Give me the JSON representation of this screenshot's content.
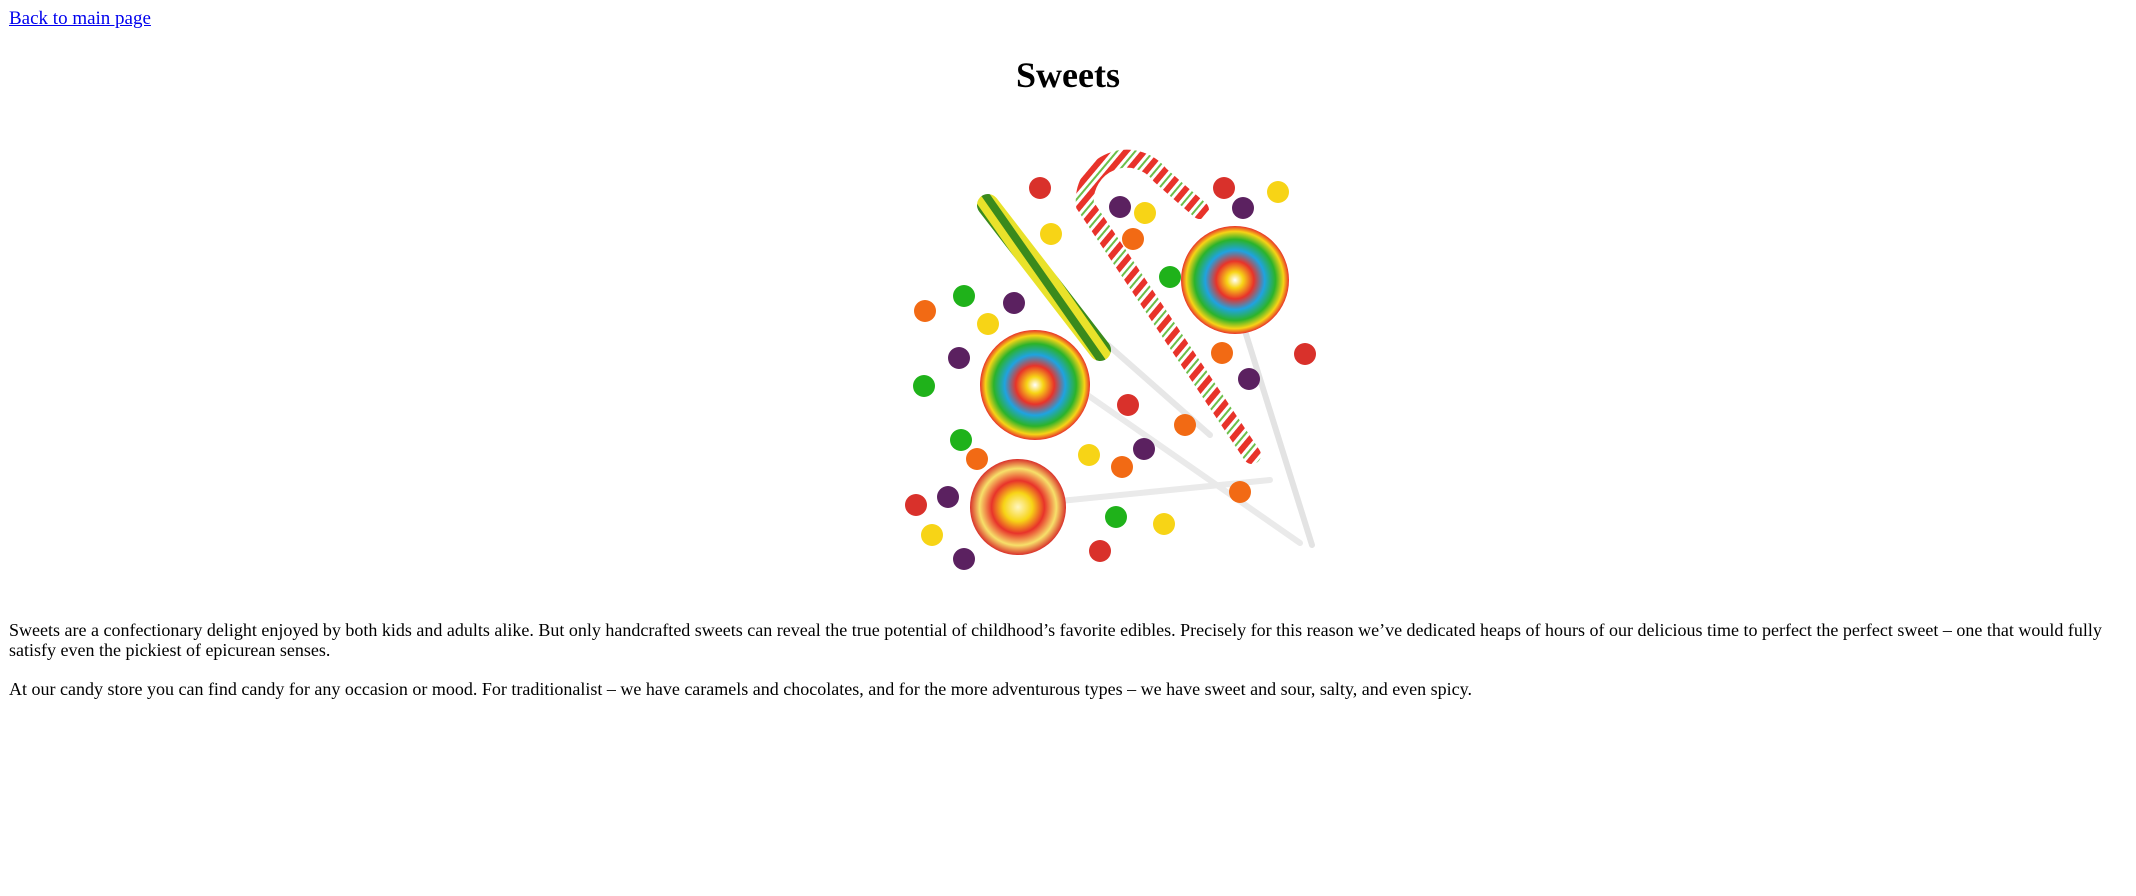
{
  "nav": {
    "back_link": "Back to main page"
  },
  "page": {
    "title": "Sweets"
  },
  "hero_image": {
    "icon": "candy-assortment",
    "candy_colors": {
      "red": "#d9312b",
      "yellow": "#f7d416",
      "orange": "#f26a14",
      "green": "#1fb21a",
      "purple": "#5b2160"
    }
  },
  "content": {
    "paragraph_1": "Sweets are a confectionary delight enjoyed by both kids and adults alike. But only handcrafted sweets can reveal the true potential of childhood’s favorite edibles. Precisely for this reason we’ve dedicated heaps of hours of our delicious time to perfect the perfect sweet – one that would fully satisfy even the pickiest of epicurean senses.",
    "paragraph_2": "At our candy store you can find candy for any occasion or mood. For traditionalist – we have caramels and chocolates, and for the more adventurous types – we have sweet and sour, salty, and even spicy."
  }
}
